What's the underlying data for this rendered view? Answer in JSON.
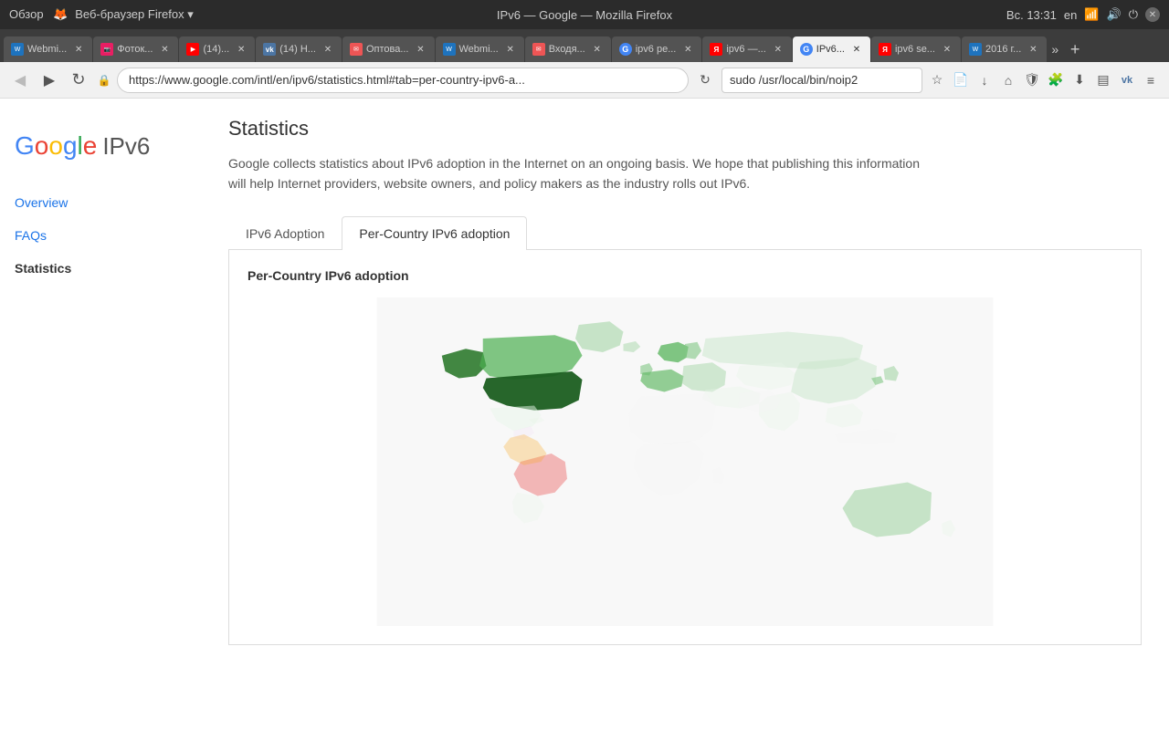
{
  "browser": {
    "title": "IPv6 — Google — Mozilla Firefox",
    "datetime": "Вс. 13:31",
    "os_label": "Обзор",
    "lang": "en",
    "url": "https://www.google.com/intl/en/ipv6/statistics.html#tab=per-country-ipv6-a...",
    "search_value": "sudo /usr/local/bin/noip2"
  },
  "tabs": [
    {
      "id": "t1",
      "label": "Webmi...",
      "favicon": "wm",
      "active": false
    },
    {
      "id": "t2",
      "label": "Фоток...",
      "favicon": "fotok",
      "active": false
    },
    {
      "id": "t3",
      "label": "(14)...",
      "favicon": "yt",
      "active": false
    },
    {
      "id": "t4",
      "label": "(14) Н...",
      "favicon": "vk",
      "active": false
    },
    {
      "id": "t5",
      "label": "Оптова...",
      "favicon": "mail",
      "active": false
    },
    {
      "id": "t6",
      "label": "Webmi...",
      "favicon": "wm",
      "active": false
    },
    {
      "id": "t7",
      "label": "Входя...",
      "favicon": "mail",
      "active": false
    },
    {
      "id": "t8",
      "label": "ipv6 ре...",
      "favicon": "g",
      "active": false
    },
    {
      "id": "t9",
      "label": "ipv6 —...",
      "favicon": "ya",
      "active": false
    },
    {
      "id": "t10",
      "label": "IPv6...",
      "favicon": "g",
      "active": true
    },
    {
      "id": "t11",
      "label": "ipv6 se...",
      "favicon": "ya",
      "active": false
    },
    {
      "id": "t12",
      "label": "2016 г...",
      "favicon": "wm",
      "active": false
    }
  ],
  "sidebar": {
    "overview_label": "Overview",
    "faqs_label": "FAQs",
    "statistics_label": "Statistics"
  },
  "page": {
    "title": "Statistics",
    "description": "Google collects statistics about IPv6 adoption in the Internet on an ongoing basis. We hope that publishing this information will help Internet providers, website owners, and policy makers as the industry rolls out IPv6.",
    "tabs": [
      {
        "id": "ipv6-adoption",
        "label": "IPv6 Adoption",
        "active": false
      },
      {
        "id": "per-country",
        "label": "Per-Country IPv6 adoption",
        "active": true
      }
    ],
    "panel_title": "Per-Country IPv6 adoption"
  },
  "logo": {
    "google": "Google",
    "ipv6": "IPv6"
  },
  "icons": {
    "back": "◀",
    "forward": "▶",
    "reload": "↻",
    "home": "⌂",
    "bookmark": "☆",
    "download": "↓",
    "menu": "≡",
    "close": "✕",
    "lock": "🔒",
    "star": "★",
    "overflow": "»"
  }
}
